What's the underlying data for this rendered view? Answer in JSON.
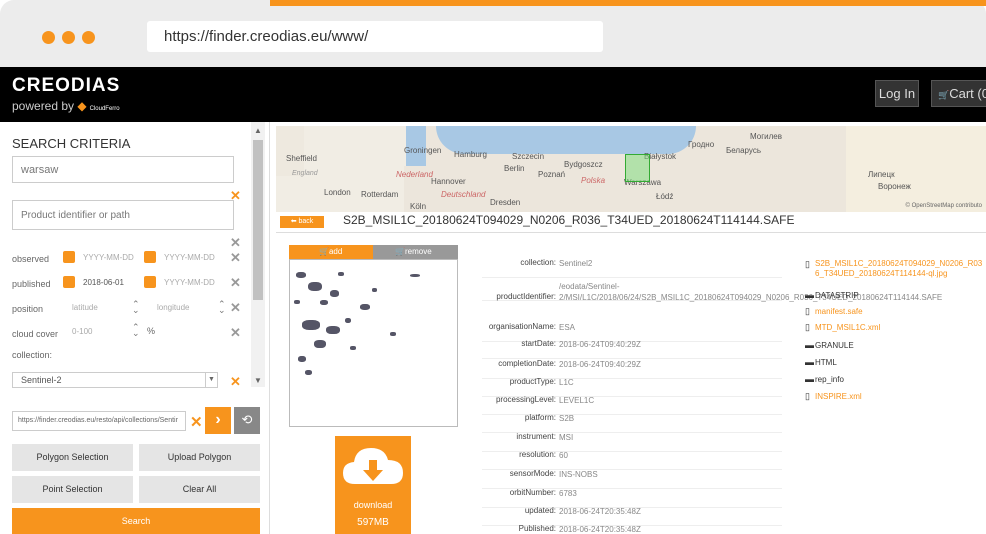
{
  "browser": {
    "url": "https://finder.creodias.eu/www/"
  },
  "header": {
    "logo": "CREODIAS",
    "powered_by": "powered by",
    "powered_brand": "CloudFerro",
    "login": "Log In",
    "cart": "Cart (0"
  },
  "search": {
    "title": "SEARCH CRITERIA",
    "location_value": "warsaw",
    "product_placeholder": "Product identifier or path",
    "observed_label": "observed",
    "published_label": "published",
    "position_label": "position",
    "cloud_label": "cloud cover",
    "collection_label": "collection:",
    "date_placeholder": "YYYY-MM-DD",
    "published_from": "2018-06-01",
    "latitude_placeholder": "latitude",
    "longitude_placeholder": "longitude",
    "cloud_placeholder": "0-100",
    "percent": "%",
    "collection_value": "Sentinel-2",
    "api_url": "https://finder.creodias.eu/resto/api/collections/Sentir",
    "polygon_selection": "Polygon Selection",
    "upload_polygon": "Upload Polygon",
    "point_selection": "Point Selection",
    "clear_all": "Clear All",
    "search_button": "Search"
  },
  "map": {
    "labels": [
      {
        "t": "Groningen",
        "c": ""
      },
      {
        "t": "Hamburg",
        "c": ""
      },
      {
        "t": "Szczecin",
        "c": ""
      },
      {
        "t": "Bydgoszcz",
        "c": ""
      },
      {
        "t": "Гродно",
        "c": ""
      },
      {
        "t": "Беларусь",
        "c": ""
      },
      {
        "t": "Могилев",
        "c": ""
      },
      {
        "t": "Berlin",
        "c": ""
      },
      {
        "t": "Poznań",
        "c": ""
      },
      {
        "t": "Białystok",
        "c": ""
      },
      {
        "t": "Nederland",
        "c": "red"
      },
      {
        "t": "Hannover",
        "c": ""
      },
      {
        "t": "Polska",
        "c": "red"
      },
      {
        "t": "Warszawa",
        "c": ""
      },
      {
        "t": "Łódź",
        "c": ""
      },
      {
        "t": "London",
        "c": ""
      },
      {
        "t": "Rotterdam",
        "c": ""
      },
      {
        "t": "Deutschland",
        "c": "red"
      },
      {
        "t": "Dresden",
        "c": ""
      },
      {
        "t": "Köln",
        "c": ""
      },
      {
        "t": "Липецк",
        "c": ""
      },
      {
        "t": "Воронеж",
        "c": ""
      },
      {
        "t": "England",
        "c": "it"
      },
      {
        "t": "Sheffield",
        "c": ""
      }
    ],
    "attribution": "© OpenStreetMap contributo"
  },
  "product": {
    "back": "back",
    "title": "S2B_MSIL1C_20180624T094029_N0206_R036_T34UED_20180624T114144.SAFE",
    "add": "add",
    "remove": "remove",
    "download": "download",
    "size": "597MB",
    "metadata": [
      {
        "k": "collection:",
        "v": "Sentinel2"
      },
      {
        "k": "productIdentifier:",
        "v": "/eodata/Sentinel-2/MSI/L1C/2018/06/24/S2B_MSIL1C_20180624T094029_N0206_R036_T34UED_20180624T114144.SAFE"
      },
      {
        "k": "organisationName:",
        "v": "ESA"
      },
      {
        "k": "startDate:",
        "v": "2018-06-24T09:40:29Z"
      },
      {
        "k": "completionDate:",
        "v": "2018-06-24T09:40:29Z"
      },
      {
        "k": "productType:",
        "v": "L1C"
      },
      {
        "k": "processingLevel:",
        "v": "LEVEL1C"
      },
      {
        "k": "platform:",
        "v": "S2B"
      },
      {
        "k": "instrument:",
        "v": "MSI"
      },
      {
        "k": "resolution:",
        "v": "60"
      },
      {
        "k": "sensorMode:",
        "v": "INS-NOBS"
      },
      {
        "k": "orbitNumber:",
        "v": "6783"
      },
      {
        "k": "updated:",
        "v": "2018-06-24T20:35:48Z"
      },
      {
        "k": "Published:",
        "v": "2018-06-24T20:35:48Z"
      }
    ],
    "files": [
      {
        "name": "S2B_MSIL1C_20180624T094029_N0206_R036_T34UED_20180624T114144-ql.jpg",
        "type": "file",
        "link": true
      },
      {
        "name": "DATASTRIP",
        "type": "folder",
        "link": false
      },
      {
        "name": "manifest.safe",
        "type": "file",
        "link": true
      },
      {
        "name": "MTD_MSIL1C.xml",
        "type": "file",
        "link": true
      },
      {
        "name": "GRANULE",
        "type": "folder",
        "link": false
      },
      {
        "name": "HTML",
        "type": "folder",
        "link": false
      },
      {
        "name": "rep_info",
        "type": "folder",
        "link": false
      },
      {
        "name": "INSPIRE.xml",
        "type": "file",
        "link": true
      }
    ]
  }
}
